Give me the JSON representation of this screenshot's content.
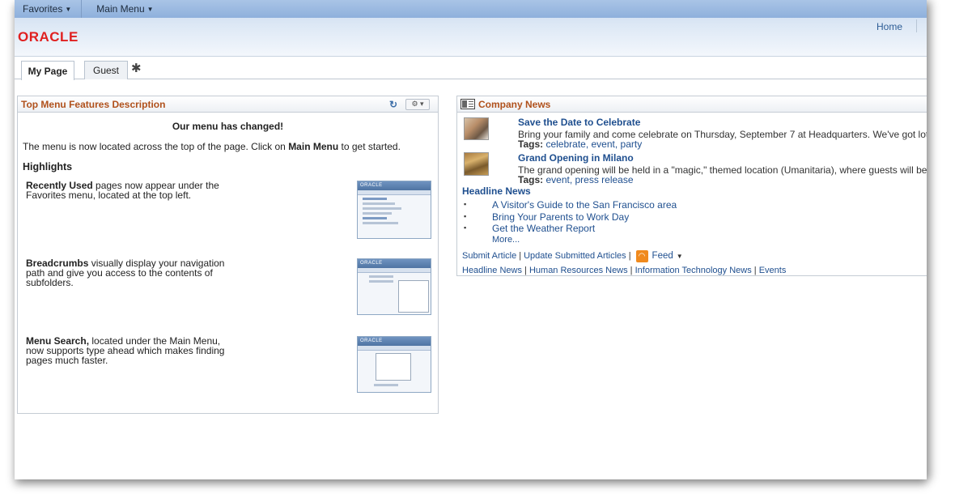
{
  "menubar": {
    "favorites": "Favorites",
    "main_menu": "Main Menu"
  },
  "header": {
    "logo": "ORACLE",
    "home": "Home"
  },
  "tabs": [
    {
      "label": "My Page"
    },
    {
      "label": "Guest"
    }
  ],
  "features_pagelet": {
    "title": "Top Menu Features Description",
    "heading": "Our menu has changed!",
    "intro_pre": "The menu is now located across the top of the page. Click on ",
    "intro_bold": "Main Menu",
    "intro_post": " to get started.",
    "highlights": "Highlights",
    "items": [
      {
        "bold": "Recently Used",
        "text": " pages now appear under the Favorites menu, located at the top left."
      },
      {
        "bold": "Breadcrumbs",
        "text": " visually display your navigation path and give you access to the contents of subfolders."
      },
      {
        "bold": "Menu Search,",
        "text": " located under the Main Menu, now supports type ahead which makes finding pages much faster."
      }
    ],
    "thumb_logo": "ORACLE"
  },
  "news_pagelet": {
    "title": "Company News",
    "articles": [
      {
        "title": "Save the Date to Celebrate",
        "desc": "Bring your family and come celebrate on Thursday, September 7 at Headquarters. We've got lots in store for you",
        "tags_label": "Tags:",
        "tags": "celebrate, event, party"
      },
      {
        "title": "Grand Opening in Milano",
        "desc": "The grand opening will be held in a \"magic,\" themed location (Umanitaria), where guests will be invited to experi",
        "tags_label": "Tags:",
        "tags": "event, press release"
      }
    ],
    "headline_title": "Headline News",
    "headlines": [
      "A Visitor's Guide to the San Francisco area",
      "Bring Your Parents to Work Day",
      "Get the Weather Report"
    ],
    "more": "More...",
    "submit_article": "Submit Article",
    "update_articles": "Update Submitted Articles",
    "feed": "Feed",
    "bottom_links": [
      "Headline News",
      "Human Resources News",
      "Information Technology News",
      "Events"
    ]
  }
}
